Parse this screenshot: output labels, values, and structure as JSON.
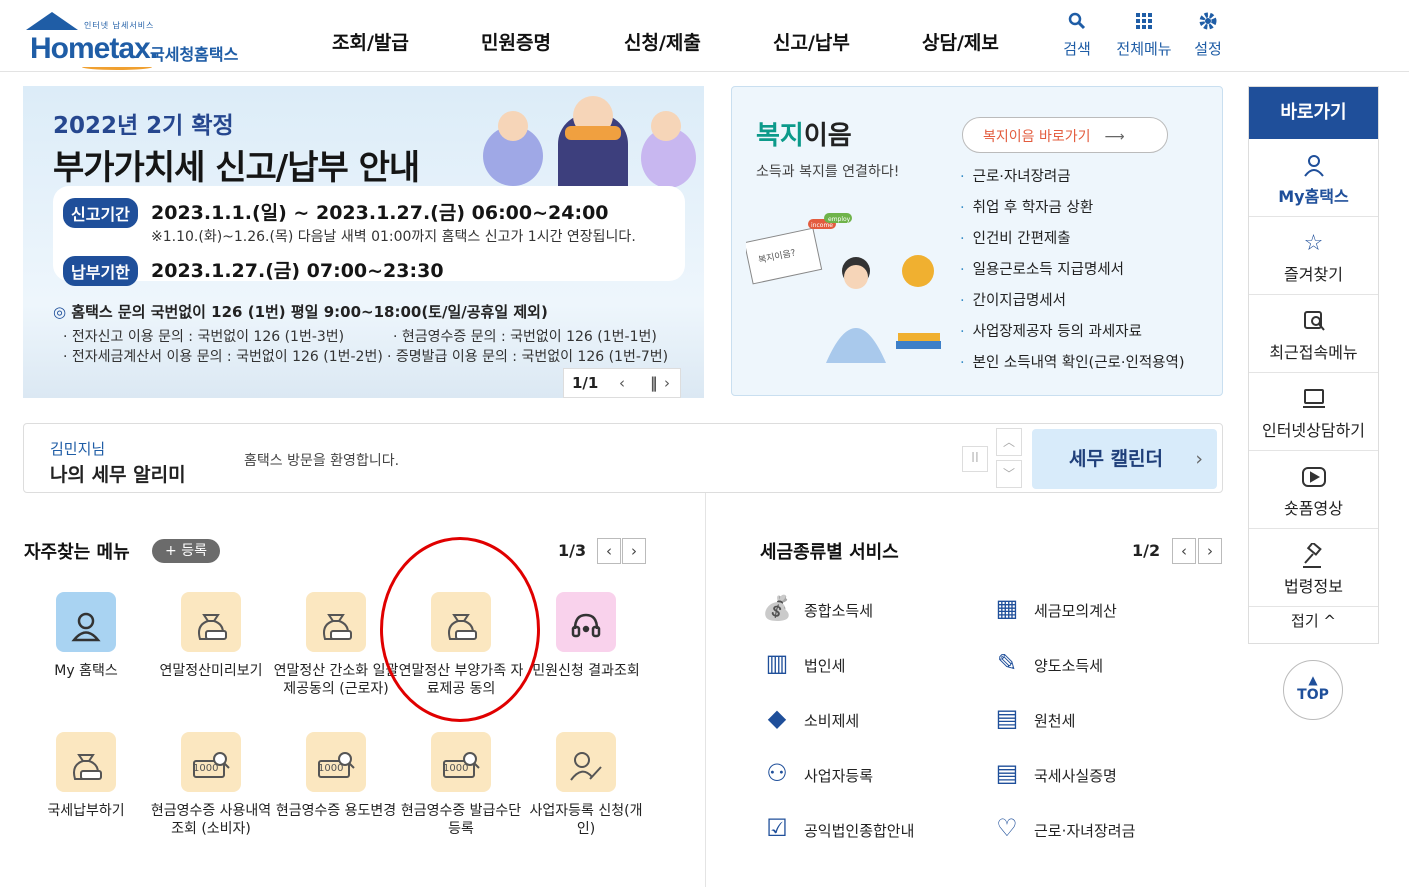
{
  "header": {
    "logo_sub": "인터넷 납세서비스",
    "logo_main": "Hometax.",
    "logo_kor": "국세청홈택스",
    "nav": [
      "조회/발급",
      "민원증명",
      "신청/제출",
      "신고/납부",
      "상담/제보"
    ],
    "tools": [
      {
        "icon": "search-icon",
        "label": "검색"
      },
      {
        "icon": "grid-menu-icon",
        "label": "전체메뉴"
      },
      {
        "icon": "gear-icon",
        "label": "설정"
      }
    ]
  },
  "banner": {
    "title1": "2022년 2기 확정",
    "title2": "부가가치세 신고/납부 안내",
    "period_chip": "신고기간",
    "period": "2023.1.1.(일) ~ 2023.1.27.(금) 06:00~24:00",
    "period_note": "※1.10.(화)~1.26.(목) 다음날 새벽 01:00까지 홈택스 신고가 1시간 연장됩니다.",
    "due_chip": "납부기한",
    "due": "2023.1.27.(금) 07:00~23:30",
    "info_main": "홈택스 문의 국번없이 126 (1번) 평일 9:00~18:00(토/일/공휴일 제외)",
    "info_lines": [
      "· 전자신고 이용 문의 : 국번없이 126 (1번-3번)",
      "· 현금영수증 문의 : 국번없이 126 (1번-1번)",
      "· 전자세금계산서 이용 문의 : 국번없이 126 (1번-2번)",
      "· 증명발급 이용 문의 : 국번없이 126 (1번-7번)"
    ],
    "pager": "1/1"
  },
  "welfare": {
    "title_a": "복지",
    "title_b": "이음",
    "subtitle": "소득과 복지를 연결하다!",
    "go_label": "복지이음 바로가기",
    "items": [
      "근로·자녀장려금",
      "취업 후 학자금 상환",
      "인건비 간편제출",
      "일용근로소득 지급명세서",
      "간이지급명세서",
      "사업장제공자 등의 과세자료",
      "본인 소득내역 확인(근로·인적용역)"
    ],
    "img_tags": [
      "복지이음?",
      "income",
      "employ"
    ]
  },
  "quick": {
    "title": "바로가기",
    "items": [
      {
        "icon": "person-icon",
        "label": "My홈택스"
      },
      {
        "icon": "star-icon",
        "label": "즐겨찾기"
      },
      {
        "icon": "recent-search-icon",
        "label": "최근접속메뉴"
      },
      {
        "icon": "monitor-chat-icon",
        "label": "인터넷상담하기"
      },
      {
        "icon": "play-icon",
        "label": "숏폼영상"
      },
      {
        "icon": "gavel-icon",
        "label": "법령정보"
      }
    ],
    "fold": "접기",
    "top": "TOP"
  },
  "alarm": {
    "name": "김민지님",
    "title": "나의 세무 알리미",
    "message": "홈택스 방문을 환영합니다.",
    "calendar": "세무 캘린더"
  },
  "frequent": {
    "title": "자주찾는 메뉴",
    "register": "+ 등록",
    "pager": "1/3",
    "items": [
      {
        "label": "My 홈택스",
        "icon": "person-icon",
        "color": "#a9d3f2"
      },
      {
        "label": "연말정산미리보기",
        "icon": "money-bag-icon",
        "color": "#fbe7c0"
      },
      {
        "label": "연말정산 간소화 일괄제공동의 (근로자)",
        "icon": "money-bag-icon",
        "color": "#fbe7c0"
      },
      {
        "label": "연말정산 부양가족 자료제공 동의",
        "icon": "money-bag-icon",
        "color": "#fbe7c0"
      },
      {
        "label": "민원신청 결과조회",
        "icon": "headset-icon",
        "color": "#f9d2ec"
      },
      {
        "label": "국세납부하기",
        "icon": "money-bag-icon",
        "color": "#fbe7c0"
      },
      {
        "label": "현금영수증 사용내역조회 (소비자)",
        "icon": "receipt-search-icon",
        "color": "#fbe7c0"
      },
      {
        "label": "현금영수증 용도변경",
        "icon": "receipt-search-icon",
        "color": "#fbe7c0"
      },
      {
        "label": "현금영수증 발급수단 등록",
        "icon": "receipt-search-icon",
        "color": "#fbe7c0"
      },
      {
        "label": "사업자등록 신청(개인)",
        "icon": "person-edit-icon",
        "color": "#fbe7c0"
      }
    ],
    "receipt_text": "1000"
  },
  "taxtype": {
    "title": "세금종류별 서비스",
    "pager": "1/2",
    "items": [
      {
        "label": "종합소득세",
        "icon": "money-bag-icon"
      },
      {
        "label": "세금모의계산",
        "icon": "calculator-icon"
      },
      {
        "label": "법인세",
        "icon": "building-icon"
      },
      {
        "label": "양도소득세",
        "icon": "document-edit-icon"
      },
      {
        "label": "소비제세",
        "icon": "diamond-icon"
      },
      {
        "label": "원천세",
        "icon": "salary-doc-icon"
      },
      {
        "label": "사업자등록",
        "icon": "person-icon"
      },
      {
        "label": "국세사실증명",
        "icon": "document-icon"
      },
      {
        "label": "공익법인종합안내",
        "icon": "clipboard-check-icon"
      },
      {
        "label": "근로·자녀장려금",
        "icon": "heart-hands-icon"
      }
    ]
  },
  "colors": {
    "brand": "#1f5da6",
    "navy": "#1f4f9a",
    "highlight": "#e00000",
    "welfare_teal": "#0c9a8a"
  }
}
